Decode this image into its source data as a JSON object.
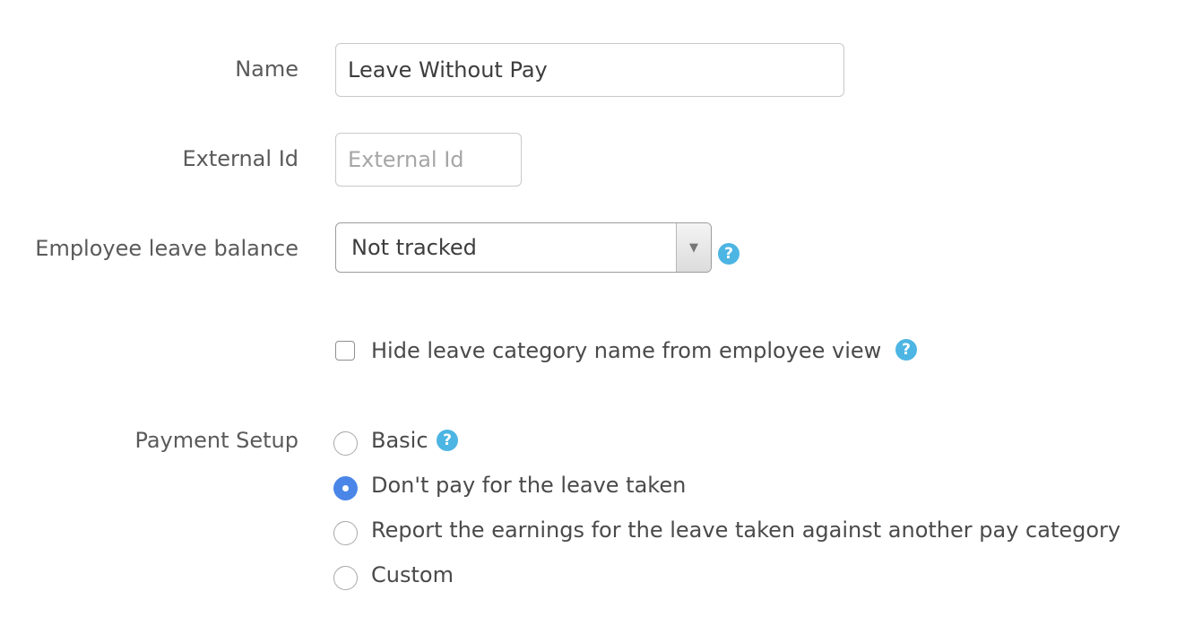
{
  "fields": {
    "name": {
      "label": "Name",
      "value": "Leave Without Pay"
    },
    "external_id": {
      "label": "External Id",
      "value": "",
      "placeholder": "External Id"
    },
    "leave_balance": {
      "label": "Employee leave balance",
      "selected": "Not tracked"
    }
  },
  "hide_name_checkbox": {
    "label": "Hide leave category name from employee view",
    "checked": false
  },
  "payment_setup": {
    "label": "Payment Setup",
    "options": [
      {
        "label": "Basic",
        "checked": false
      },
      {
        "label": "Don't pay for the leave taken",
        "checked": true
      },
      {
        "label": "Report the earnings for the leave taken against another pay category",
        "checked": false
      },
      {
        "label": "Custom",
        "checked": false
      }
    ]
  },
  "icons": {
    "help": "question-mark-circle-icon",
    "dropdown": "triangle-down-icon"
  },
  "colors": {
    "help_icon": "#4db5e3",
    "radio_selected": "#4a86e8"
  }
}
